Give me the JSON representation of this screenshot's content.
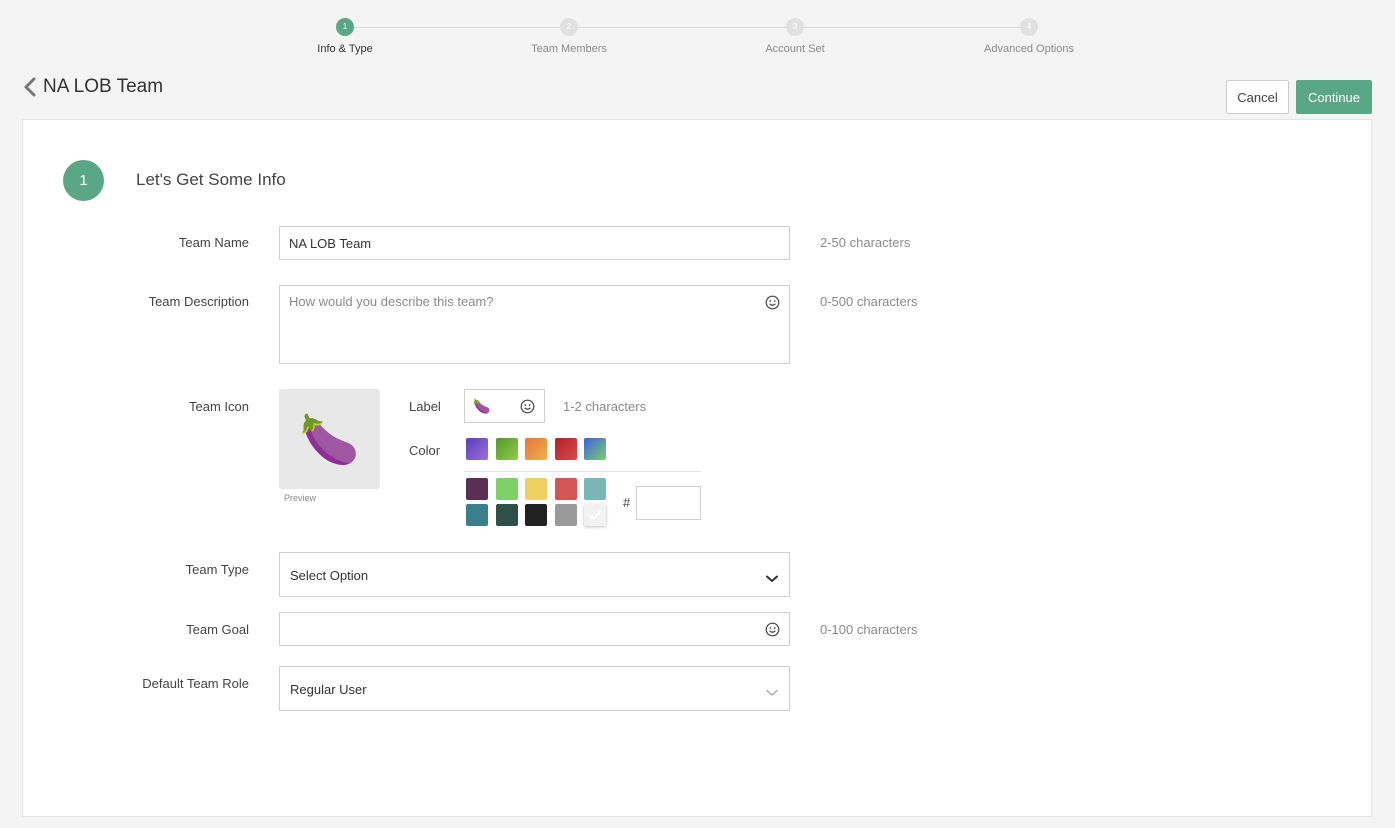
{
  "stepper": {
    "steps": [
      {
        "number": "1",
        "label": "Info & Type",
        "active": true
      },
      {
        "number": "2",
        "label": "Team Members",
        "active": false
      },
      {
        "number": "3",
        "label": "Account Set",
        "active": false
      },
      {
        "number": "4",
        "label": "Advanced Options",
        "active": false
      }
    ]
  },
  "header": {
    "title": "NA LOB Team",
    "cancel_label": "Cancel",
    "continue_label": "Continue"
  },
  "section": {
    "number": "1",
    "title": "Let's Get Some Info"
  },
  "form": {
    "team_name": {
      "label": "Team Name",
      "value": "NA LOB Team",
      "hint": "2-50 characters"
    },
    "team_description": {
      "label": "Team Description",
      "placeholder": "How would you describe this team?",
      "hint": "0-500 characters"
    },
    "team_icon": {
      "label": "Team Icon",
      "preview_emoji": "🍆",
      "preview_label": "Preview",
      "label_field_label": "Label",
      "label_value": "🍆",
      "label_hint": "1-2 characters",
      "color_label": "Color",
      "hex_prefix": "#",
      "gradient_swatches": [
        {
          "from": "#5b3fb8",
          "to": "#9a6fe0"
        },
        {
          "from": "#4e9a2a",
          "to": "#93c94d"
        },
        {
          "from": "#e5763a",
          "to": "#f0b04d"
        },
        {
          "from": "#b3212e",
          "to": "#d84a4a"
        },
        {
          "from": "#3a5fe0",
          "to": "#7fd06a"
        }
      ],
      "solid_swatches": [
        "#5b2f54",
        "#7dd168",
        "#efcf61",
        "#d45555",
        "#78b7b5",
        "#3b7f8d",
        "#2f4f48",
        "#222222",
        "#999999",
        "#f2f2f2"
      ],
      "selected_swatch_index": 9
    },
    "team_type": {
      "label": "Team Type",
      "value": "Select Option"
    },
    "team_goal": {
      "label": "Team Goal",
      "value": "",
      "hint": "0-100 characters"
    },
    "default_team_role": {
      "label": "Default Team Role",
      "value": "Regular User"
    }
  },
  "colors": {
    "accent": "#5aa788",
    "inactive_step": "#e1e1e1"
  },
  "icons": {
    "back": "chevron-left-icon",
    "emoji_picker": "smile-icon",
    "dropdown": "chevron-down-icon",
    "selected": "check-icon"
  }
}
